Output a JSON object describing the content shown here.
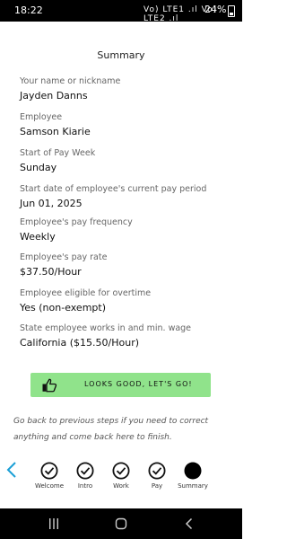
{
  "status_bar": {
    "time": "18:22",
    "indicators": "Vo) LTE1 .ıl Vo) LTE2 .ıl",
    "battery_percent": "24%",
    "icons": [
      "notification-icon",
      "alarm-icon",
      "wifi-icon",
      "signal-icon",
      "battery-icon"
    ]
  },
  "page": {
    "title": "Summary"
  },
  "fields": [
    {
      "label": "Your name or nickname",
      "value": "Jayden Danns"
    },
    {
      "label": "Employee",
      "value": "Samson Kiarie"
    },
    {
      "label": "Start of Pay Week",
      "value": "Sunday"
    },
    {
      "label": "Start date of employee's current pay period",
      "value": "Jun 01, 2025"
    },
    {
      "label": "Employee's pay frequency",
      "value": "Weekly"
    },
    {
      "label": "Employee's pay rate",
      "value": "$37.50/Hour"
    },
    {
      "label": "Employee eligible for overtime",
      "value": "Yes (non-exempt)"
    },
    {
      "label": "State employee works in and min. wage",
      "value": "California ($15.50/Hour)"
    }
  ],
  "confirm_button": {
    "label": "LOOKS GOOD, LET'S GO!",
    "icon": "thumbs-up-icon",
    "color": "#90e38b"
  },
  "hint_text": "Go back to previous steps if you need to correct anything and come back here to finish.",
  "steps": [
    {
      "label": "Welcome",
      "state": "completed"
    },
    {
      "label": "Intro",
      "state": "completed"
    },
    {
      "label": "Work",
      "state": "completed"
    },
    {
      "label": "Pay",
      "state": "completed"
    },
    {
      "label": "Summary",
      "state": "current"
    }
  ],
  "colors": {
    "accent": "#1a9fd6",
    "button": "#90e38b"
  }
}
